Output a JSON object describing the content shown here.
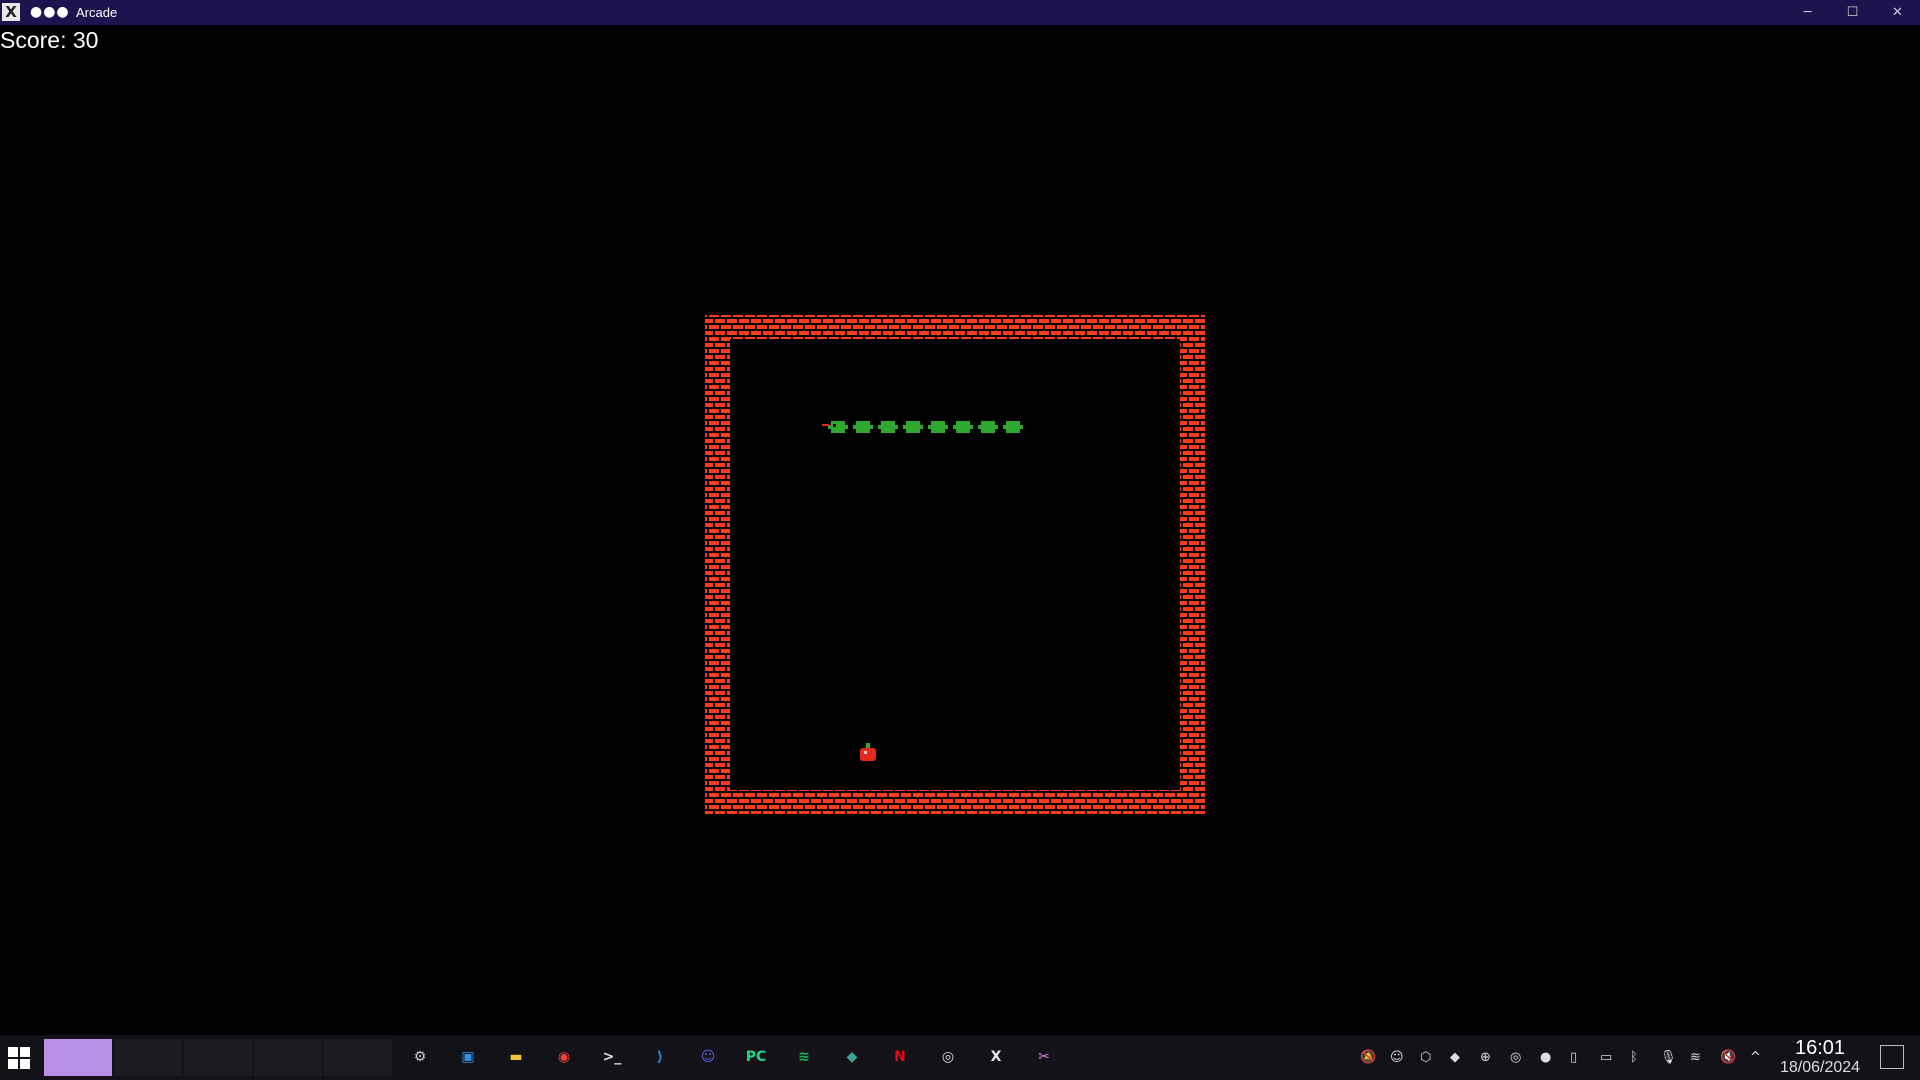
{
  "window": {
    "app_icon": "X",
    "dots": "●●●",
    "title": "Arcade",
    "minimize": "─",
    "maximize": "☐",
    "close": "✕"
  },
  "game": {
    "score_text": "Score: 30",
    "colors": {
      "wall": "#ff3b1f",
      "snake": "#2fa82f",
      "food": "#e8281e",
      "background": "#000000"
    },
    "snake_segments": 8,
    "snake_direction": "left"
  },
  "taskbar": {
    "start_icon": "windows-logo-icon",
    "pinned": [
      {
        "name": "settings-icon",
        "glyph": "⚙",
        "color": "#cfcfcf"
      },
      {
        "name": "store-icon",
        "glyph": "▣",
        "color": "#2d8ee6"
      },
      {
        "name": "file-explorer-icon",
        "glyph": "▬",
        "color": "#f3c43b"
      },
      {
        "name": "chrome-icon",
        "glyph": "◉",
        "color": "#e94235"
      },
      {
        "name": "terminal-icon",
        "glyph": ">_",
        "color": "#e0e0e0"
      },
      {
        "name": "vscode-icon",
        "glyph": "⟩",
        "color": "#2a8fd6"
      },
      {
        "name": "discord-icon",
        "glyph": "☺",
        "color": "#5865f2"
      },
      {
        "name": "pycharm-icon",
        "glyph": "PC",
        "color": "#21d789"
      },
      {
        "name": "spotify-icon",
        "glyph": "≋",
        "color": "#1db954"
      },
      {
        "name": "app-diamond-icon",
        "glyph": "◆",
        "color": "#3aa39b"
      },
      {
        "name": "netflix-icon",
        "glyph": "N",
        "color": "#e50914"
      },
      {
        "name": "obs-icon",
        "glyph": "◎",
        "color": "#dcdcdc"
      },
      {
        "name": "arcade-app-icon",
        "glyph": "X",
        "color": "#e8e8e8"
      },
      {
        "name": "snipping-tool-icon",
        "glyph": "✂",
        "color": "#d88bd8"
      }
    ],
    "tray": [
      {
        "name": "notification-off-icon",
        "glyph": "🔕"
      },
      {
        "name": "discord-tray-icon",
        "glyph": "☺"
      },
      {
        "name": "box-tray-icon",
        "glyph": "⬡"
      },
      {
        "name": "cube-tray-icon",
        "glyph": "◆"
      },
      {
        "name": "upload-tray-icon",
        "glyph": "⊕"
      },
      {
        "name": "obs-tray-icon",
        "glyph": "◎"
      },
      {
        "name": "record-tray-icon",
        "glyph": "●"
      },
      {
        "name": "clipboard-tray-icon",
        "glyph": "▯"
      },
      {
        "name": "battery-tray-icon",
        "glyph": "▭"
      },
      {
        "name": "bluetooth-icon",
        "glyph": "ᛒ"
      },
      {
        "name": "mic-muted-icon",
        "glyph": "🎙"
      },
      {
        "name": "wifi-icon",
        "glyph": "≋"
      },
      {
        "name": "volume-muted-icon",
        "glyph": "🔇"
      },
      {
        "name": "show-hidden-icons-chevron",
        "glyph": "^"
      }
    ],
    "clock_time": "16:01",
    "clock_date": "18/06/2024"
  }
}
